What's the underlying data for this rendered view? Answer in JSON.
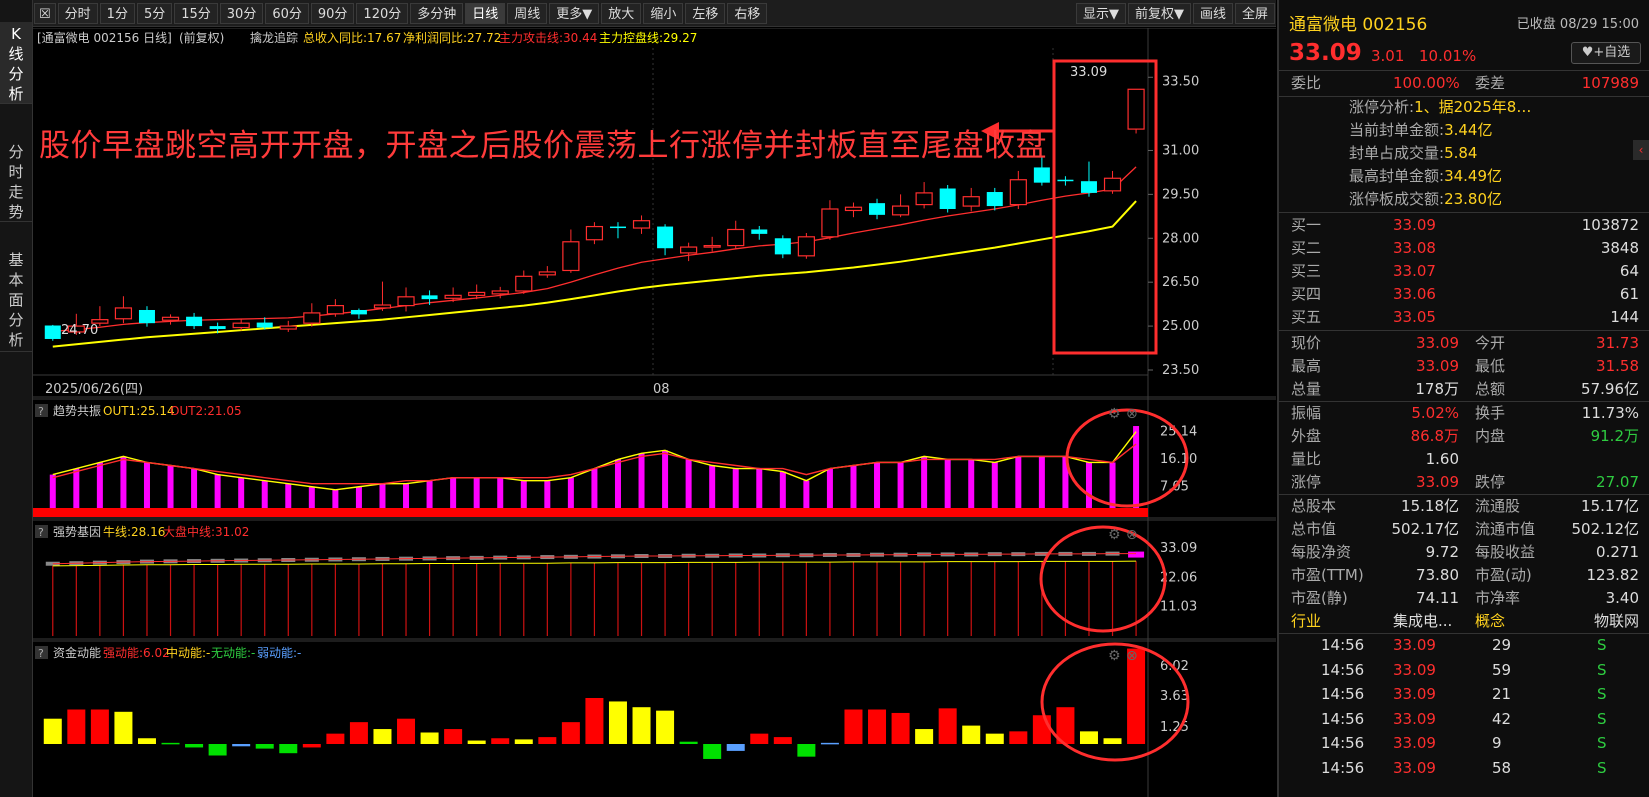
{
  "left_tabs": [
    "K线分析",
    "分时走势",
    "基本面分析"
  ],
  "toolbar": {
    "items": [
      "分时",
      "1分",
      "5分",
      "15分",
      "30分",
      "60分",
      "90分",
      "120分",
      "多分钟",
      "日线",
      "周线",
      "更多▼",
      "放大",
      "缩小",
      "左移",
      "右移"
    ],
    "right_items": [
      "显示▼",
      "前复权▼",
      "画线",
      "全屏"
    ],
    "active": "日线"
  },
  "main_chart": {
    "legend": {
      "name": "[通富微电 002156 日线]",
      "adj": "(前复权)",
      "ind": "擒龙追踪",
      "f1": "总收入同比:17.67",
      "f2": "净利润同比:27.72",
      "f3": "主力攻击线:30.44",
      "f4": "主力控盘线:29.27"
    },
    "y_ticks": [
      "33.50",
      "31.00",
      "29.50",
      "28.00",
      "26.50",
      "25.00",
      "23.50"
    ],
    "date_left": "2025/06/26(四)",
    "date_mid": "08",
    "low_label": "24.70",
    "high_label": "33.09",
    "annotation": "股价早盘跳空高开开盘，开盘之后股价震荡上行涨停并封板直至尾盘收盘"
  },
  "chart_data": [
    {
      "type": "candlestick",
      "title": "通富微电 002156 日线",
      "ylim": [
        23.5,
        34.5
      ],
      "candles": [
        [
          25.02,
          24.56,
          25.04,
          24.5
        ],
        [
          24.8,
          25.0,
          25.42,
          24.7
        ],
        [
          25.1,
          25.22,
          25.68,
          25.0
        ],
        [
          25.25,
          25.62,
          26.02,
          25.1
        ],
        [
          25.55,
          25.1,
          25.68,
          24.98
        ],
        [
          25.2,
          25.3,
          25.4,
          25.05
        ],
        [
          25.32,
          25.0,
          25.45,
          24.9
        ],
        [
          25.0,
          24.9,
          25.12,
          24.75
        ],
        [
          24.95,
          25.1,
          25.25,
          24.85
        ],
        [
          25.12,
          24.95,
          25.3,
          24.88
        ],
        [
          24.9,
          25.0,
          25.18,
          24.8
        ],
        [
          25.1,
          25.45,
          25.78,
          24.98
        ],
        [
          25.42,
          25.7,
          25.92,
          25.32
        ],
        [
          25.55,
          25.4,
          25.6,
          25.25
        ],
        [
          25.62,
          25.72,
          26.52,
          25.52
        ],
        [
          25.7,
          26.0,
          26.32,
          25.5
        ],
        [
          26.05,
          25.92,
          26.22,
          25.72
        ],
        [
          25.95,
          26.05,
          26.32,
          25.82
        ],
        [
          26.05,
          26.15,
          26.42,
          25.92
        ],
        [
          26.1,
          26.2,
          26.34,
          25.95
        ],
        [
          26.2,
          26.7,
          26.9,
          26.1
        ],
        [
          26.75,
          26.85,
          27.05,
          26.65
        ],
        [
          26.9,
          27.88,
          28.3,
          26.82
        ],
        [
          27.95,
          28.4,
          28.55,
          27.8
        ],
        [
          28.4,
          28.35,
          28.55,
          28.0
        ],
        [
          28.35,
          28.6,
          28.78,
          28.15
        ],
        [
          28.4,
          27.66,
          28.48,
          27.42
        ],
        [
          27.5,
          27.7,
          27.85,
          27.22
        ],
        [
          27.7,
          27.75,
          28.05,
          27.55
        ],
        [
          27.75,
          28.3,
          28.6,
          27.62
        ],
        [
          28.3,
          28.15,
          28.42,
          27.95
        ],
        [
          28.0,
          27.45,
          28.1,
          27.32
        ],
        [
          27.4,
          28.05,
          28.18,
          27.3
        ],
        [
          28.05,
          29.0,
          29.3,
          27.95
        ],
        [
          28.95,
          29.06,
          29.22,
          28.72
        ],
        [
          29.2,
          28.8,
          29.35,
          28.65
        ],
        [
          28.8,
          29.1,
          29.5,
          28.72
        ],
        [
          29.15,
          29.55,
          29.92,
          29.02
        ],
        [
          29.7,
          29.0,
          29.82,
          28.88
        ],
        [
          29.1,
          29.42,
          29.72,
          28.92
        ],
        [
          29.58,
          29.1,
          29.72,
          28.95
        ],
        [
          29.15,
          30.0,
          30.3,
          29.0
        ],
        [
          30.42,
          29.9,
          30.8,
          29.8
        ],
        [
          30.0,
          29.95,
          30.12,
          29.8
        ],
        [
          29.95,
          29.55,
          30.62,
          29.42
        ],
        [
          29.62,
          30.05,
          30.3,
          29.52
        ],
        [
          31.73,
          33.09,
          33.09,
          31.58
        ]
      ],
      "series": [
        {
          "name": "主力攻击线",
          "values": [
            24.82,
            24.88,
            24.96,
            25.06,
            25.12,
            25.16,
            25.2,
            25.22,
            25.24,
            25.26,
            25.28,
            25.34,
            25.42,
            25.5,
            25.6,
            25.7,
            25.8,
            25.88,
            25.96,
            26.05,
            26.15,
            26.28,
            26.5,
            26.75,
            26.98,
            27.18,
            27.3,
            27.42,
            27.52,
            27.64,
            27.74,
            27.8,
            27.88,
            28.02,
            28.18,
            28.32,
            28.46,
            28.62,
            28.76,
            28.88,
            29.0,
            29.14,
            29.3,
            29.44,
            29.55,
            29.68,
            30.44
          ]
        },
        {
          "name": "主力控盘线",
          "values": [
            24.3,
            24.38,
            24.46,
            24.54,
            24.62,
            24.68,
            24.74,
            24.8,
            24.86,
            24.92,
            24.98,
            25.04,
            25.1,
            25.16,
            25.22,
            25.3,
            25.38,
            25.46,
            25.54,
            25.62,
            25.7,
            25.8,
            25.92,
            26.05,
            26.18,
            26.3,
            26.4,
            26.48,
            26.56,
            26.64,
            26.72,
            26.78,
            26.84,
            26.92,
            27.0,
            27.1,
            27.2,
            27.32,
            27.44,
            27.56,
            27.68,
            27.82,
            27.96,
            28.1,
            28.24,
            28.4,
            29.27
          ]
        }
      ]
    },
    {
      "type": "bar",
      "title": "趋势共振",
      "y_ticks": [
        "25.14",
        "16.10",
        "7.05"
      ],
      "legend": [
        "OUT1:25.14",
        "OUT2:21.05"
      ],
      "values": [
        11,
        13,
        15,
        17,
        15,
        14,
        13,
        11,
        10,
        9,
        8,
        7,
        6,
        7,
        8,
        8,
        9,
        10,
        10,
        10,
        9,
        9,
        10,
        13,
        16,
        18,
        19,
        16,
        14,
        13,
        13,
        12,
        9,
        13,
        14,
        15,
        15,
        17,
        16,
        16,
        15,
        17,
        17,
        17,
        15,
        15,
        27
      ],
      "series": [
        {
          "name": "OUT1",
          "values": [
            11,
            13,
            15,
            17,
            15,
            14,
            13,
            11,
            10,
            9,
            8,
            7,
            6,
            7,
            8,
            8,
            9,
            10,
            10,
            10,
            9,
            9,
            10,
            13,
            16,
            18,
            19,
            16,
            14,
            13,
            13,
            12,
            9,
            13,
            14,
            15,
            15,
            17,
            16,
            16,
            15,
            17,
            17,
            17,
            15,
            15,
            25.14
          ]
        },
        {
          "name": "OUT2",
          "values": [
            10,
            12,
            14,
            16,
            15,
            14,
            13,
            12,
            11,
            10,
            9,
            8,
            8,
            8,
            8,
            9,
            9,
            10,
            10,
            10,
            10,
            10,
            11,
            13,
            15,
            17,
            18,
            16,
            15,
            14,
            13,
            13,
            11,
            13,
            14,
            15,
            15,
            16,
            16,
            16,
            16,
            17,
            17,
            17,
            16,
            15,
            21.05
          ]
        }
      ]
    },
    {
      "type": "bar",
      "title": "强势基因",
      "y_ticks": [
        "33.09",
        "22.06",
        "11.03"
      ],
      "legend": [
        "牛线:28.16",
        "大盘中线:31.02"
      ],
      "series": [
        {
          "name": "牛线",
          "values": [
            26.4,
            26.5,
            26.6,
            26.7,
            26.8,
            26.8,
            26.9,
            26.9,
            27.0,
            27.0,
            27.0,
            27.1,
            27.1,
            27.1,
            27.2,
            27.2,
            27.3,
            27.3,
            27.3,
            27.4,
            27.4,
            27.4,
            27.5,
            27.5,
            27.6,
            27.6,
            27.6,
            27.7,
            27.7,
            27.7,
            27.8,
            27.8,
            27.8,
            27.8,
            27.9,
            27.9,
            27.9,
            27.9,
            28.0,
            28.0,
            28.0,
            28.0,
            28.1,
            28.1,
            28.1,
            28.1,
            28.16
          ]
        },
        {
          "name": "大盘中线",
          "values": [
            27.2,
            27.4,
            27.6,
            27.8,
            28.0,
            28.1,
            28.2,
            28.3,
            28.4,
            28.5,
            28.6,
            28.7,
            28.8,
            28.9,
            29.0,
            29.1,
            29.2,
            29.3,
            29.4,
            29.5,
            29.6,
            29.7,
            29.8,
            29.9,
            30.0,
            30.1,
            30.1,
            30.2,
            30.2,
            30.3,
            30.3,
            30.4,
            30.4,
            30.5,
            30.5,
            30.6,
            30.6,
            30.7,
            30.7,
            30.7,
            30.8,
            30.8,
            30.9,
            30.9,
            30.9,
            31.0,
            31.02
          ]
        }
      ]
    },
    {
      "type": "bar",
      "title": "资金动能",
      "y_ticks": [
        "6.02",
        "3.63",
        "1.25"
      ],
      "legend": [
        "强动能:6.02",
        "中动能:-",
        "无动能:-",
        "弱动能:-"
      ],
      "values": [
        2.2,
        3.0,
        3.0,
        2.8,
        0.5,
        0.1,
        -0.3,
        -1.0,
        -0.2,
        -0.4,
        -0.8,
        -0.3,
        0.9,
        1.9,
        1.3,
        2.2,
        1.0,
        1.3,
        0.3,
        0.5,
        0.4,
        0.6,
        1.9,
        4.0,
        3.7,
        3.2,
        2.9,
        0.2,
        -1.3,
        -0.6,
        0.9,
        0.6,
        -1.1,
        0.1,
        3.0,
        3.0,
        2.7,
        1.3,
        3.1,
        1.6,
        0.9,
        1.1,
        2.5,
        3.2,
        1.1,
        0.5,
        8.3
      ],
      "colors": [
        "yel",
        "red",
        "red",
        "yel",
        "yel",
        "grn",
        "grn",
        "grn",
        "blu",
        "grn",
        "grn",
        "red",
        "red",
        "red",
        "yel",
        "red",
        "yel",
        "red",
        "yel",
        "red",
        "yel",
        "red",
        "red",
        "red",
        "yel",
        "yel",
        "yel",
        "grn",
        "grn",
        "blu",
        "red",
        "red",
        "grn",
        "blu",
        "red",
        "red",
        "red",
        "yel",
        "red",
        "yel",
        "yel",
        "red",
        "red",
        "red",
        "yel",
        "yel",
        "red"
      ]
    }
  ],
  "panels": {
    "p1": {
      "name": "趋势共振",
      "l1": "OUT1:25.14",
      "l2": "OUT2:21.05"
    },
    "p2": {
      "name": "强势基因",
      "l1": "牛线:28.16",
      "l2": "大盘中线:31.02"
    },
    "p3": {
      "name": "资金动能",
      "l1": "强动能:6.02",
      "l2": "中动能:-",
      "l3": "无动能:-",
      "l4": "弱动能:-"
    }
  },
  "quote": {
    "name": "通富微电 002156",
    "status": "已收盘 08/29 15:00",
    "price": "33.09",
    "change": "3.01",
    "pct": "10.01%",
    "fav_btn": "♥+自选",
    "weibi_label": "委比",
    "weibi": "100.00%",
    "weicha_label": "委差",
    "weicha": "107989",
    "limit": [
      [
        "涨停分析:",
        "1、据2025年8…"
      ],
      [
        "当前封单金额:",
        "3.44亿"
      ],
      [
        "封单占成交量:",
        "5.84"
      ],
      [
        "最高封单金额:",
        "34.49亿"
      ],
      [
        "涨停板成交额:",
        "23.80亿"
      ]
    ],
    "bids": [
      [
        "买一",
        "33.09",
        "103872"
      ],
      [
        "买二",
        "33.08",
        "3848"
      ],
      [
        "买三",
        "33.07",
        "64"
      ],
      [
        "买四",
        "33.06",
        "61"
      ],
      [
        "买五",
        "33.05",
        "144"
      ]
    ],
    "stats": [
      [
        "现价",
        "33.09",
        "今开",
        "31.73"
      ],
      [
        "最高",
        "33.09",
        "最低",
        "31.58"
      ],
      [
        "总量",
        "178万",
        "总额",
        "57.96亿"
      ],
      [
        "振幅",
        "5.02%",
        "换手",
        "11.73%"
      ],
      [
        "外盘",
        "86.8万",
        "内盘",
        "91.2万"
      ],
      [
        "量比",
        "1.60",
        "",
        ""
      ],
      [
        "涨停",
        "33.09",
        "跌停",
        "27.07"
      ],
      [
        "总股本",
        "15.18亿",
        "流通股",
        "15.17亿"
      ],
      [
        "总市值",
        "502.17亿",
        "流通市值",
        "502.12亿"
      ],
      [
        "每股净资",
        "9.72",
        "每股收益",
        "0.271"
      ],
      [
        "市盈(TTM)",
        "73.80",
        "市盈(动)",
        "123.82"
      ],
      [
        "市盈(静)",
        "74.11",
        "市净率",
        "3.40"
      ]
    ],
    "industry": [
      "行业",
      "集成电...",
      "概念",
      "物联网"
    ],
    "ticks": [
      [
        "14:56",
        "33.09",
        "29",
        "S"
      ],
      [
        "14:56",
        "33.09",
        "59",
        "S"
      ],
      [
        "14:56",
        "33.09",
        "21",
        "S"
      ],
      [
        "14:56",
        "33.09",
        "42",
        "S"
      ],
      [
        "14:56",
        "33.09",
        "9",
        "S"
      ],
      [
        "14:56",
        "33.09",
        "58",
        "S"
      ]
    ]
  },
  "colors": {
    "up": "#ff2e2e",
    "down": "#00ffff",
    "ma1": "#ff2e2e",
    "ma2": "#ffff00",
    "magenta": "#ff00ff",
    "bg": "#000000"
  }
}
